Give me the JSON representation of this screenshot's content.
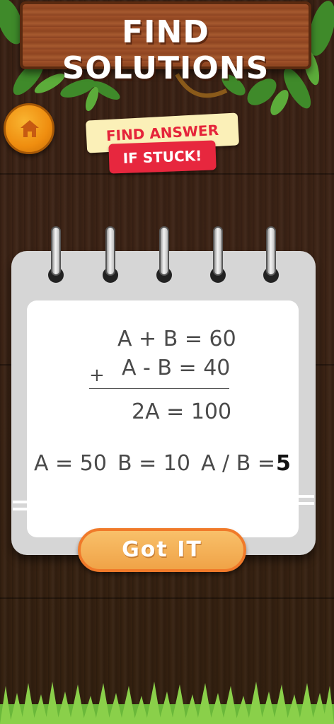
{
  "header": {
    "title": "FIND SOLUTIONS"
  },
  "home_button": {
    "icon": "home-icon"
  },
  "hint": {
    "line1": "FIND ANSWER",
    "line2": "IF STUCK!"
  },
  "solution": {
    "eq1": "A + B = 60",
    "operator": "+",
    "eq2": "A - B = 40",
    "sum": "2A = 100",
    "result_a": "A = 50",
    "result_b": "B = 10",
    "result_ratio_label": "A / B =",
    "result_ratio_value": "5"
  },
  "action": {
    "label": "Got IT"
  },
  "colors": {
    "background": "#3a2114",
    "board": "#a0522a",
    "home_button": "#ef8d0f",
    "hint_badge": "#fbf0b8",
    "hint_text": "#e5243a",
    "stuck_badge": "#e7273e",
    "button": "#f8c06a",
    "button_border": "#f07a2a"
  }
}
